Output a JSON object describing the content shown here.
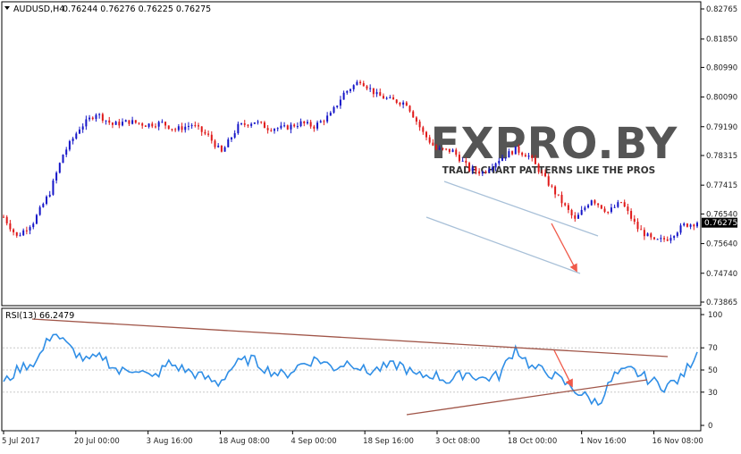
{
  "header": {
    "symbol_info": "AUDUSD,H4",
    "ohlc": "0.76244 0.76276 0.76225 0.76275",
    "current_price": "0.76275"
  },
  "watermark": {
    "brand": "FXPRO.BY",
    "tagline": "TRADE CHART PATTERNS LIKE THE PROS"
  },
  "rsi": {
    "label": "RSI(13) 66.2479"
  },
  "colors": {
    "bull_candle": "#1515c8",
    "bear_candle": "#e01919",
    "rsi_line": "#2f8ee6",
    "channel_line": "#a8c0d8",
    "triangle_line": "#a05548",
    "arrow": "#f05a4a",
    "grid": "#c8c8c8",
    "axis_text": "#222222",
    "price_box": "#000000"
  },
  "chart_data": [
    {
      "type": "candlestick",
      "title": "AUDUSD,H4",
      "y_ticks": [
        "0.82765",
        "0.81850",
        "0.80990",
        "0.80090",
        "0.79190",
        "0.78315",
        "0.77415",
        "0.76540",
        "0.75640",
        "0.74740",
        "0.73865"
      ],
      "ylim": [
        0.73865,
        0.82765
      ],
      "x_tick_labels": [
        "5 Jul 2017",
        "20 Jul 00:00",
        "3 Aug 16:00",
        "18 Aug 08:00",
        "4 Sep 00:00",
        "18 Sep 16:00",
        "3 Oct 08:00",
        "18 Oct 00:00",
        "1 Nov 16:00",
        "16 Nov 08:00"
      ],
      "anchors": [
        [
          0,
          0.7645
        ],
        [
          4,
          0.7585
        ],
        [
          9,
          0.763
        ],
        [
          14,
          0.772
        ],
        [
          18,
          0.7835
        ],
        [
          23,
          0.7915
        ],
        [
          28,
          0.796
        ],
        [
          33,
          0.7925
        ],
        [
          38,
          0.7935
        ],
        [
          43,
          0.7925
        ],
        [
          48,
          0.793
        ],
        [
          52,
          0.791
        ],
        [
          57,
          0.7925
        ],
        [
          62,
          0.789
        ],
        [
          66,
          0.784
        ],
        [
          71,
          0.792
        ],
        [
          76,
          0.7935
        ],
        [
          80,
          0.7915
        ],
        [
          85,
          0.7915
        ],
        [
          90,
          0.793
        ],
        [
          94,
          0.792
        ],
        [
          99,
          0.7955
        ],
        [
          103,
          0.802
        ],
        [
          108,
          0.806
        ],
        [
          113,
          0.8015
        ],
        [
          117,
          0.8
        ],
        [
          122,
          0.799
        ],
        [
          127,
          0.79
        ],
        [
          131,
          0.785
        ],
        [
          136,
          0.7845
        ],
        [
          141,
          0.779
        ],
        [
          145,
          0.778
        ],
        [
          150,
          0.782
        ],
        [
          155,
          0.785
        ],
        [
          159,
          0.783
        ],
        [
          164,
          0.776
        ],
        [
          169,
          0.769
        ],
        [
          173,
          0.7635
        ],
        [
          178,
          0.77
        ],
        [
          183,
          0.766
        ],
        [
          187,
          0.769
        ],
        [
          192,
          0.761
        ],
        [
          197,
          0.757
        ],
        [
          201,
          0.758
        ],
        [
          206,
          0.762
        ],
        [
          210,
          0.7627
        ]
      ],
      "last": 0.76275,
      "candle_count": 211
    },
    {
      "type": "line",
      "title": "RSI(13) 66.2479",
      "y_ticks": [
        "100",
        "70",
        "50",
        "30",
        "0"
      ],
      "ylim": [
        0,
        100
      ],
      "anchors": [
        [
          0,
          38
        ],
        [
          5,
          52
        ],
        [
          10,
          58
        ],
        [
          15,
          85
        ],
        [
          20,
          70
        ],
        [
          25,
          58
        ],
        [
          30,
          62
        ],
        [
          35,
          48
        ],
        [
          40,
          52
        ],
        [
          45,
          42
        ],
        [
          50,
          56
        ],
        [
          55,
          50
        ],
        [
          60,
          44
        ],
        [
          65,
          38
        ],
        [
          70,
          55
        ],
        [
          75,
          60
        ],
        [
          80,
          50
        ],
        [
          85,
          45
        ],
        [
          90,
          55
        ],
        [
          95,
          60
        ],
        [
          100,
          52
        ],
        [
          105,
          58
        ],
        [
          110,
          48
        ],
        [
          115,
          52
        ],
        [
          120,
          55
        ],
        [
          125,
          44
        ],
        [
          130,
          46
        ],
        [
          135,
          40
        ],
        [
          140,
          48
        ],
        [
          145,
          42
        ],
        [
          150,
          45
        ],
        [
          155,
          70
        ],
        [
          160,
          52
        ],
        [
          165,
          48
        ],
        [
          170,
          38
        ],
        [
          175,
          28
        ],
        [
          180,
          20
        ],
        [
          185,
          45
        ],
        [
          190,
          50
        ],
        [
          195,
          42
        ],
        [
          200,
          35
        ],
        [
          205,
          42
        ],
        [
          210,
          66
        ]
      ],
      "last": 66.2479
    }
  ]
}
